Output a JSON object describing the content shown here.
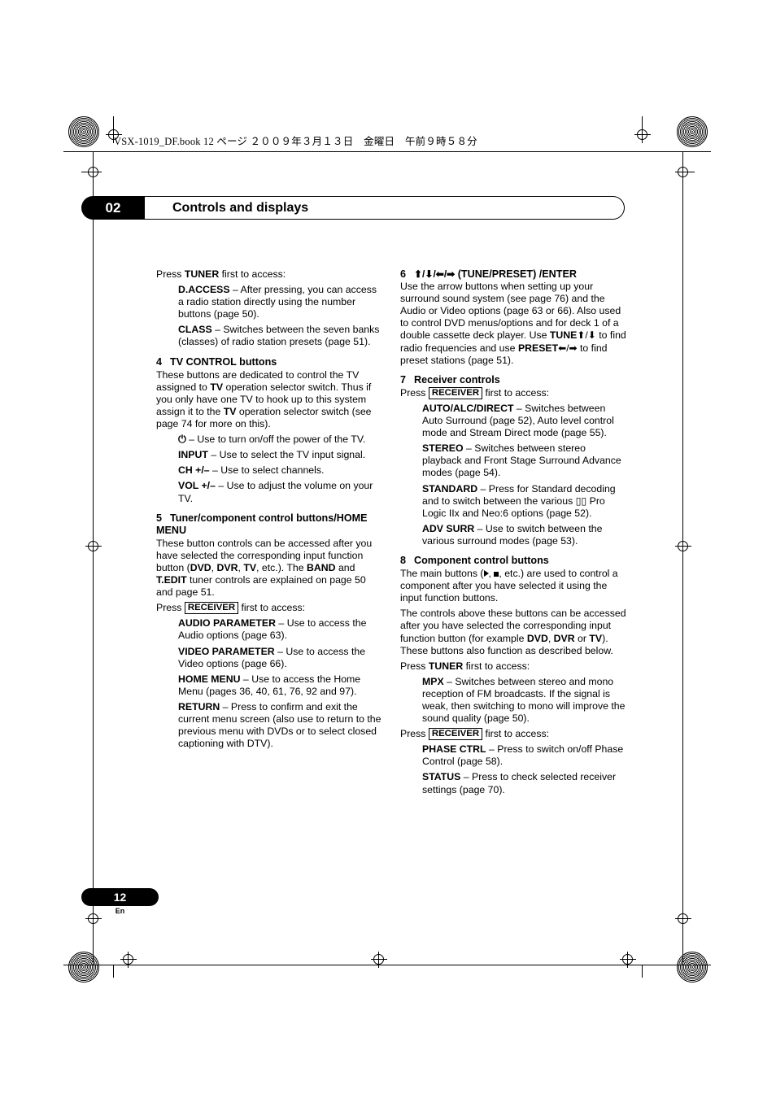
{
  "header": {
    "book_line": "VSX-1019_DF.book   12 ページ   ２００９年３月１３日　金曜日　午前９時５８分"
  },
  "chapter": {
    "number": "02",
    "title": "Controls and displays"
  },
  "left_column": {
    "intro": {
      "lead_pre": "Press ",
      "lead_bold": "TUNER",
      "lead_post": " first to access:"
    },
    "items": [
      {
        "term": "D.ACCESS",
        "text": " – After pressing, you can access a radio station directly using the number buttons (page 50)."
      },
      {
        "term": "CLASS",
        "text": " – Switches between the seven banks (classes) of radio station presets (page 51)."
      }
    ],
    "section4": {
      "num": "4",
      "title": "TV CONTROL buttons",
      "body_1": "These buttons are dedicated to control the TV assigned to ",
      "body_bold_1": "TV",
      "body_2": " operation selector switch. Thus if you only have one TV to hook up to this system assign it to the ",
      "body_bold_2": "TV",
      "body_3": " operation selector switch (see page 74 for more on this).",
      "bullets": [
        {
          "term": "⏻",
          "text": " – Use to turn on/off the power of the TV."
        },
        {
          "term": "INPUT",
          "text": " – Use to select the TV input signal."
        },
        {
          "term": "CH +/–",
          "text": " – Use to select channels."
        },
        {
          "term": "VOL +/–",
          "text": " – Use to adjust the volume on your TV."
        }
      ]
    },
    "section5": {
      "num": "5",
      "title": "Tuner/component control buttons/HOME MENU",
      "body_1": "These button controls can be accessed after you have selected the corresponding input function button (",
      "body_bold_1": "DVD",
      "body_2": ", ",
      "body_bold_2": "DVR",
      "body_3": ", ",
      "body_bold_3": "TV",
      "body_4": ", etc.). The ",
      "body_bold_4": "BAND",
      "body_5": " and ",
      "body_bold_5": "T.EDIT",
      "body_6": " tuner controls are explained on page 50 and page 51.",
      "press_pre": "Press ",
      "press_boxed": "RECEIVER",
      "press_post": " first to access:",
      "items": [
        {
          "term": "AUDIO PARAMETER",
          "text": " – Use to access the Audio options (page 63)."
        },
        {
          "term": "VIDEO PARAMETER",
          "text": " – Use to access the Video options (page 66)."
        },
        {
          "term": "HOME MENU",
          "text": " – Use to access the Home Menu (pages 36, 40, 61, 76, 92 and 97)."
        },
        {
          "term": "RETURN",
          "text": " – Press to confirm and exit the current menu screen (also use to return to the previous menu with DVDs or to select closed captioning with DTV)."
        }
      ]
    }
  },
  "right_column": {
    "section6": {
      "num": "6",
      "title_icons": "⬆/⬇/⬅/➡",
      "title_text": " (TUNE/PRESET) /ENTER",
      "body_1": "Use the arrow buttons when setting up your surround sound system (see page 76) and the Audio or Video options (page 63 or 66). Also used to control DVD menus/options and for deck 1 of a double cassette deck player. Use ",
      "body_bold_1": "TUNE",
      "body_icons_1": "⬆/⬇",
      "body_2": " to find radio frequencies and use ",
      "body_bold_2": "PRESET",
      "body_icons_2": "⬅/➡",
      "body_3": " to find preset stations (page 51)."
    },
    "section7": {
      "num": "7",
      "title": "Receiver controls",
      "press_pre": "Press ",
      "press_boxed": "RECEIVER",
      "press_post": " first to access:",
      "items": [
        {
          "term": "AUTO/ALC/DIRECT",
          "text": " – Switches between Auto Surround (page 52), Auto level control mode and Stream Direct mode (page 55)."
        },
        {
          "term": "STEREO",
          "text": " – Switches between stereo playback and Front Stage Surround Advance modes (page 54)."
        },
        {
          "term": "STANDARD",
          "text": " – Press for Standard decoding and to switch between the various ▯▯ Pro Logic IIx and Neo:6 options (page 52)."
        },
        {
          "term": "ADV SURR",
          "text": " – Use to switch between the various surround modes (page 53)."
        }
      ]
    },
    "section8": {
      "num": "8",
      "title": "Component control buttons",
      "body_1": "The main buttons (",
      "body_icon_play": "▶",
      "body_2": ", ",
      "body_icon_stop": "■",
      "body_3": ", etc.) are used to control a component after you have selected it using the input function buttons.",
      "body_4": "The controls above these buttons can be accessed after you have selected the corresponding input function button (for example ",
      "body_bold_1": "DVD",
      "body_5": ", ",
      "body_bold_2": "DVR",
      "body_6": " or ",
      "body_bold_3": "TV",
      "body_7": "). These buttons also function as described below.",
      "press_tuner_pre": "Press ",
      "press_tuner_bold": "TUNER",
      "press_tuner_post": " first to access:",
      "tuner_items": [
        {
          "term": "MPX",
          "text": " – Switches between stereo and mono reception of FM broadcasts. If the signal is weak, then switching to mono will improve the sound quality (page 50)."
        }
      ],
      "press_receiver_pre": "Press ",
      "press_receiver_boxed": "RECEIVER",
      "press_receiver_post": " first to access:",
      "receiver_items": [
        {
          "term": "PHASE CTRL",
          "text": " – Press to switch on/off Phase Control (page 58)."
        },
        {
          "term": "STATUS",
          "text": " – Press to check selected receiver settings (page 70)."
        }
      ]
    }
  },
  "footer": {
    "page_number": "12",
    "language": "En"
  }
}
